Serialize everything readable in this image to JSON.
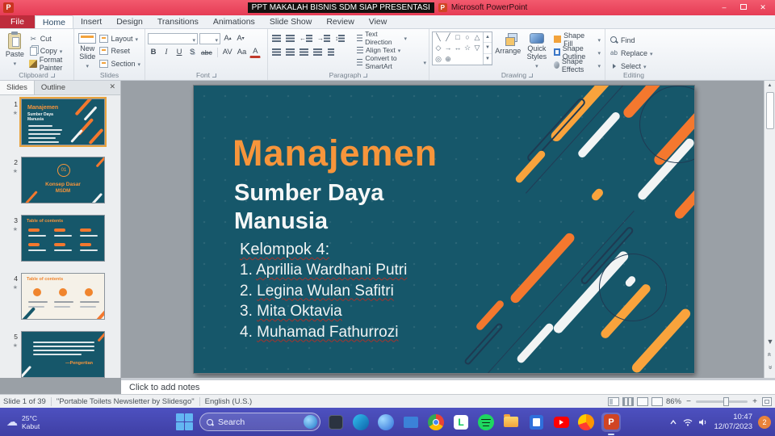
{
  "titlebar": {
    "title_main": "PPT MAKALAH BISNIS SDM SIAP PRESENTASI",
    "title_app": "Microsoft PowerPoint",
    "minimize_glyph": "–",
    "close_glyph": "✕"
  },
  "tabs": {
    "file": "File",
    "home": "Home",
    "insert": "Insert",
    "design": "Design",
    "transitions": "Transitions",
    "animations": "Animations",
    "slideshow": "Slide Show",
    "review": "Review",
    "view": "View"
  },
  "clipboard": {
    "group": "Clipboard",
    "paste": "Paste",
    "cut": "Cut",
    "copy": "Copy",
    "format_painter": "Format Painter"
  },
  "slides_group": {
    "group": "Slides",
    "new_slide": "New Slide",
    "layout": "Layout",
    "reset": "Reset",
    "section": "Section"
  },
  "font_group": {
    "group": "Font",
    "bold": "B",
    "italic": "I",
    "underline": "U",
    "strike": "abc",
    "shadow": "S",
    "spacing": "AV",
    "case": "Aa",
    "color": "A",
    "grow": "A",
    "shrink": "A"
  },
  "paragraph_group": {
    "group": "Paragraph",
    "text_direction": "Text Direction",
    "align_text": "Align Text",
    "smartart": "Convert to SmartArt"
  },
  "drawing_group": {
    "group": "Drawing",
    "arrange": "Arrange",
    "quick_styles": "Quick Styles",
    "shape_fill": "Shape Fill",
    "shape_outline": "Shape Outline",
    "shape_effects": "Shape Effects"
  },
  "editing_group": {
    "group": "Editing",
    "find": "Find",
    "replace": "Replace",
    "select": "Select"
  },
  "panel": {
    "tab_slides": "Slides",
    "tab_outline": "Outline",
    "thumbs": [
      {
        "num": "1"
      },
      {
        "num": "2"
      },
      {
        "num": "3"
      },
      {
        "num": "4"
      },
      {
        "num": "5"
      }
    ],
    "t1": {
      "title": "Manajemen",
      "subtitle": "Sumber Daya Manusia"
    },
    "t2": {
      "badge": "01",
      "caption1": "Konsep Dasar",
      "caption2": "MSDM"
    },
    "t3": {
      "header": "Table of contents"
    },
    "t4": {
      "header": "Table of contents"
    },
    "t5": {
      "caption": "—Pengertian"
    }
  },
  "slide": {
    "title": "Manajemen",
    "sub1": "Sumber Daya",
    "sub2": "Manusia",
    "kelompok": "Kelompok 4:",
    "m1_no": "1.",
    "m1_name": "Aprillia Wardhani Putri",
    "m2_no": "2.",
    "m2_name": "Legina Wulan Safitri",
    "m3_no": "3.",
    "m3_name": "Mita Oktavia",
    "m4_no": "4.",
    "m4_name": "Muhamad Fathurrozi"
  },
  "notes": {
    "placeholder": "Click to add notes"
  },
  "statusbar": {
    "slide_info": "Slide 1 of 39",
    "theme": "\"Portable Toilets Newsletter by Slidesgo\"",
    "language": "English (U.S.)",
    "zoom": "86%"
  },
  "taskbar": {
    "weather_temp": "25°C",
    "weather_desc": "Kabut",
    "search_placeholder": "Search",
    "time": "10:47",
    "date": "12/07/2023",
    "badge": "2"
  },
  "icons": {
    "dropdown": "▾",
    "star": "★",
    "scissors": "✂",
    "cloud": "☁"
  },
  "colors": {
    "titlebar_pink": "#e84a5f",
    "file_tab_red": "#be2c3c",
    "slide_teal": "#16576a",
    "accent_orange": "#f4782e",
    "accent_orange_light": "#f9a33c",
    "taskbar_indigo": "#4646b4"
  }
}
